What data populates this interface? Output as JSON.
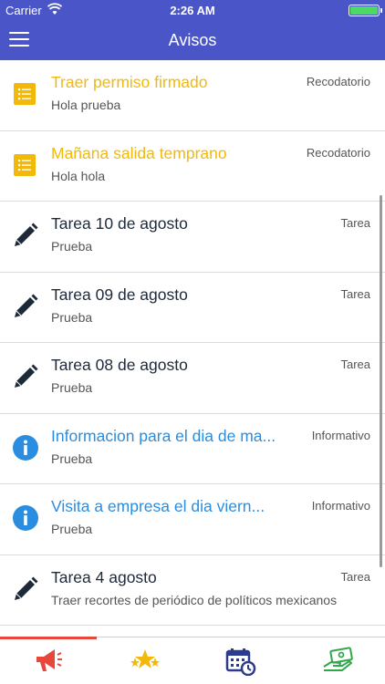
{
  "status_bar": {
    "carrier": "Carrier",
    "time": "2:26 AM"
  },
  "header": {
    "title": "Avisos",
    "menu_icon": "hamburger-menu-icon"
  },
  "colors": {
    "header_bg": "#4a55c8",
    "recordatorio": "#f2b90a",
    "tarea": "#1e2a3a",
    "informativo": "#2a8de0",
    "active_tab_indicator": "#e8473b"
  },
  "notices": [
    {
      "title": "Traer permiso firmado",
      "subtitle": "Hola prueba",
      "category": "Recodatorio",
      "type": "recordatorio",
      "icon": "note-list-icon"
    },
    {
      "title": "Mañana salida temprano",
      "subtitle": "Hola hola",
      "category": "Recodatorio",
      "type": "recordatorio",
      "icon": "note-list-icon"
    },
    {
      "title": "Tarea 10 de agosto",
      "subtitle": "Prueba",
      "category": "Tarea",
      "type": "tarea",
      "icon": "pencil-icon"
    },
    {
      "title": "Tarea 09 de agosto",
      "subtitle": "Prueba",
      "category": "Tarea",
      "type": "tarea",
      "icon": "pencil-icon"
    },
    {
      "title": "Tarea 08 de agosto",
      "subtitle": "Prueba",
      "category": "Tarea",
      "type": "tarea",
      "icon": "pencil-icon"
    },
    {
      "title": "Informacion para el dia de ma...",
      "subtitle": "Prueba",
      "category": "Informativo",
      "type": "informativo",
      "icon": "info-icon"
    },
    {
      "title": "Visita a empresa el dia viern...",
      "subtitle": "Prueba",
      "category": "Informativo",
      "type": "informativo",
      "icon": "info-icon"
    },
    {
      "title": "Tarea 4 agosto",
      "subtitle": "Traer recortes de periódico de políticos mexicanos",
      "category": "Tarea",
      "type": "tarea",
      "icon": "pencil-icon"
    }
  ],
  "tabs": [
    {
      "icon": "megaphone-icon",
      "active": true
    },
    {
      "icon": "stars-icon",
      "active": false
    },
    {
      "icon": "calendar-clock-icon",
      "active": false
    },
    {
      "icon": "hand-money-icon",
      "active": false
    }
  ]
}
